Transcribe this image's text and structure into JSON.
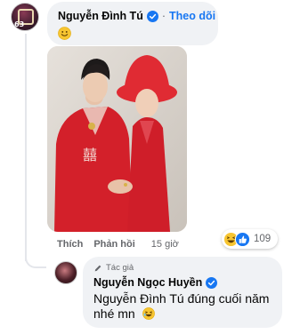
{
  "comment": {
    "author": "Nguyễn Đình Tú",
    "separator": "·",
    "follow_label": "Theo dõi",
    "avatar_badge": "63",
    "body_icon": "smiley-emoji-icon"
  },
  "photo": {
    "colors": {
      "backdrop": "#d9d3cc",
      "outfit": "#d3202a",
      "hat": "#e02b33"
    }
  },
  "actions": {
    "like_label": "Thích",
    "reply_label": "Phản hồi",
    "time": "15 giờ"
  },
  "reactions": {
    "icons": [
      "haha-reaction-icon",
      "like-reaction-icon"
    ],
    "count": "109"
  },
  "reply": {
    "author_tag": "Tác giả",
    "author": "Nguyễn Ngọc Huyền",
    "text": "Nguyễn Đình Tú đúng cuối năm nhé mn",
    "text_emoji": "laughing-emoji-icon"
  },
  "colors": {
    "link": "#1877f2",
    "bubble": "#f0f2f5",
    "muted": "#65676b"
  }
}
